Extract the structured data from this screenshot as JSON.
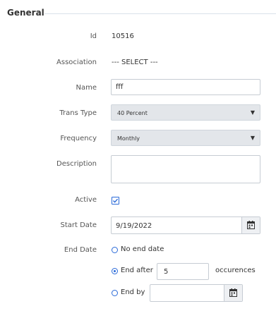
{
  "section": {
    "title": "General"
  },
  "fields": {
    "id": {
      "label": "Id",
      "value": "10516"
    },
    "association": {
      "label": "Association",
      "value": "--- SELECT ---"
    },
    "name": {
      "label": "Name",
      "value": "fff"
    },
    "trans_type": {
      "label": "Trans Type",
      "value": "40 Percent"
    },
    "frequency": {
      "label": "Frequency",
      "value": "Monthly"
    },
    "description": {
      "label": "Description",
      "value": ""
    },
    "active": {
      "label": "Active",
      "checked": true
    },
    "start_date": {
      "label": "Start Date",
      "value": "9/19/2022"
    },
    "end_date": {
      "label": "End Date",
      "options": {
        "no_end": {
          "label": "No end date",
          "selected": false
        },
        "end_after": {
          "label": "End after",
          "selected": true,
          "count": "5",
          "suffix": "occurences"
        },
        "end_by": {
          "label": "End by",
          "selected": false,
          "value": ""
        }
      }
    }
  },
  "icons": {
    "dropdown": "triangle-down",
    "calendar": "calendar-icon",
    "check": "checkmark"
  },
  "colors": {
    "accent": "#2a6ad8",
    "select_bg": "#e3e6ea",
    "border": "#c6ccd3",
    "divider": "#d9e1ea"
  }
}
